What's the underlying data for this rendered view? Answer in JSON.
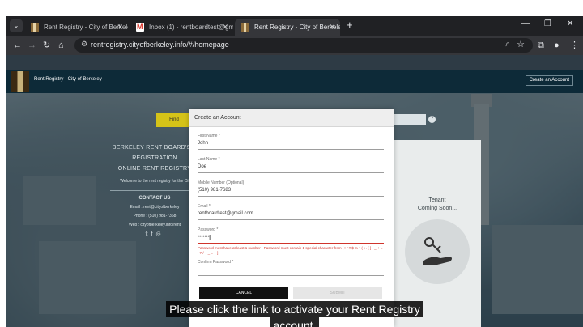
{
  "browser": {
    "tabs": [
      {
        "title": "Rent Registry - City of Berkeley",
        "favicon": "rent-registry-favicon",
        "active": false
      },
      {
        "title": "Inbox (1) - rentboardtest@gmail",
        "favicon": "gmail-icon",
        "active": false
      },
      {
        "title": "Rent Registry - City of Berkeley",
        "favicon": "rent-registry-favicon",
        "active": true
      }
    ],
    "url": "rentregistry.cityofberkeley.info/#/homepage"
  },
  "site": {
    "title": "Rent Registry - City of Berkeley",
    "create_account_button": "Create an Account",
    "find_button": "Find",
    "left_panel": {
      "heading_lines": [
        "BERKELEY RENT BOARD'S C",
        "REGISTRATION",
        "ONLINE RENT REGISTRY"
      ],
      "welcome": "Welcome to the rent registry for the Cit",
      "contact_heading": "CONTACT US",
      "email": "Email : rent@cityofberkeley",
      "phone": "Phone : (510) 981-7368",
      "web": "Web : cityofberkeley.info/rent"
    },
    "tenant_card": {
      "line1": "Tenant",
      "line2": "Coming Soon..."
    }
  },
  "modal": {
    "title": "Create an Account",
    "fields": [
      {
        "label": "First Name *",
        "value": "John"
      },
      {
        "label": "Last Name *",
        "value": "Doe"
      },
      {
        "label": "Mobile Number (Optional)",
        "value": "(510) 981-7683"
      },
      {
        "label": "Email *",
        "value": "rentboardtest@gmail.com"
      },
      {
        "label": "Password *",
        "value": "•••••••"
      },
      {
        "label": "Confirm Password *",
        "value": ""
      }
    ],
    "password_error": "Password must have at least 1 number · Password must contain 1 special character from [ ! \" # $ % * ( ) . [ ] - _ + = . ? / ~ _ = ~ ]",
    "cancel_button": "CANCEL",
    "submit_button": "SUBMIT"
  },
  "captions": [
    "Please click the link to activate your Rent Registry",
    "account."
  ],
  "colors": {
    "find_button": "#d5c318",
    "error_text": "#d0342c",
    "site_header": "#0d2a38"
  }
}
